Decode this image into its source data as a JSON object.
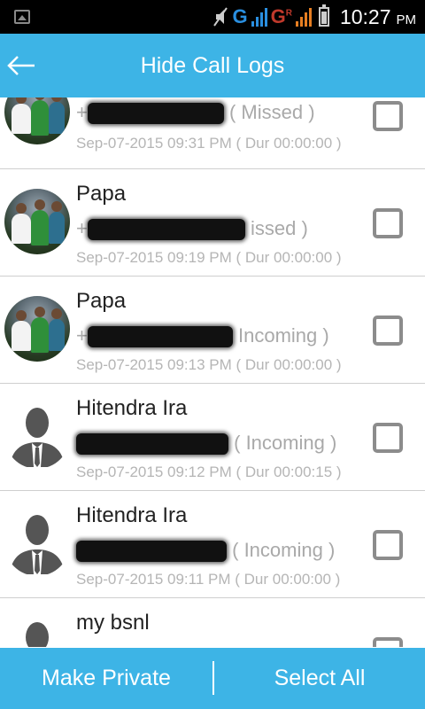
{
  "status_bar": {
    "time": "10:27",
    "ampm": "PM",
    "network_1": "G",
    "network_2": "G",
    "network_2_sup": "R",
    "icons": [
      "image-icon",
      "mute-icon",
      "signal-icon",
      "battery-icon"
    ]
  },
  "toolbar": {
    "title": "Hide Call Logs",
    "back_icon": "back-arrow-icon"
  },
  "calls": [
    {
      "name": "",
      "prefix": "+",
      "type": "( Missed )",
      "time": "Sep-07-2015 09:31 PM ( Dur  00:00:00 )",
      "avatar": "photo"
    },
    {
      "name": "Papa",
      "prefix": "+",
      "type": "issed )",
      "time": "Sep-07-2015 09:19 PM ( Dur  00:00:00 )",
      "avatar": "photo"
    },
    {
      "name": "Papa",
      "prefix": "+",
      "type": "Incoming )",
      "time": "Sep-07-2015 09:13 PM ( Dur  00:00:00 )",
      "avatar": "photo"
    },
    {
      "name": "Hitendra Ira",
      "prefix": "",
      "type": "( Incoming )",
      "time": "Sep-07-2015 09:12 PM ( Dur  00:00:15 )",
      "avatar": "silhouette"
    },
    {
      "name": "Hitendra Ira",
      "prefix": "",
      "type": "( Incoming )",
      "time": "Sep-07-2015 09:11 PM ( Dur  00:00:00 )",
      "avatar": "silhouette"
    },
    {
      "name": "my bsnl",
      "prefix": "",
      "type": "",
      "time": "",
      "avatar": "silhouette"
    }
  ],
  "bottom_bar": {
    "make_private": "Make Private",
    "select_all": "Select All"
  },
  "colors": {
    "accent": "#3db4e6",
    "status_bar": "#000000",
    "text_primary": "#222222",
    "text_secondary": "#a9a9a9",
    "checkbox_border": "#8c8c8c"
  }
}
